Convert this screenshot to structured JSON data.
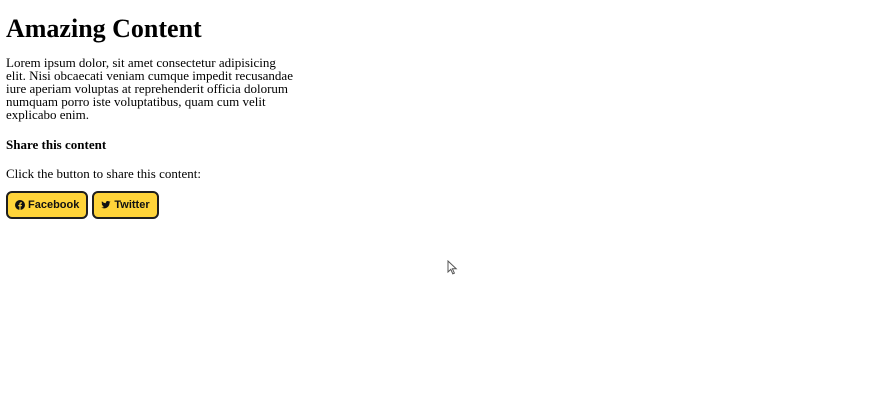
{
  "page": {
    "title": "Amazing Content",
    "intro": "Lorem ipsum dolor, sit amet consectetur adipisicing elit. Nisi obcaecati veniam cumque impedit recusandae iure aperiam voluptas at reprehenderit officia dolorum numquam porro iste voluptatibus, quam cum velit explicabo enim.",
    "share_heading": "Share this content",
    "share_text": "Click the button to share this content:"
  },
  "buttons": [
    {
      "label": "Facebook",
      "icon": "facebook-icon"
    },
    {
      "label": "Twitter",
      "icon": "twitter-icon"
    }
  ],
  "colors": {
    "button_bg": "#ffd43a",
    "button_border": "#1f1f1f"
  }
}
